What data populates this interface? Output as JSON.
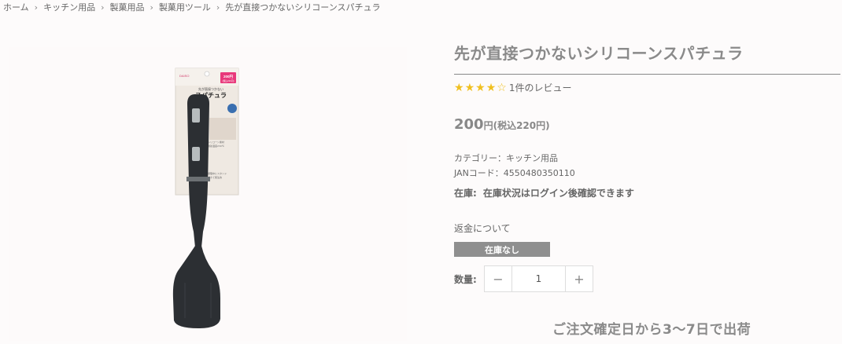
{
  "breadcrumb": [
    "ホーム",
    "キッチン用品",
    "製菓用品",
    "製菓用ツール",
    "先が直接つかないシリコーンスパチュラ"
  ],
  "product": {
    "title": "先が直接つかないシリコーンスパチュラ",
    "rating": 4,
    "rating_max": 5,
    "review_text": "1件のレビュー",
    "price": "200",
    "price_unit": "円",
    "price_tax": "(税込220円)",
    "category": "カテゴリー：キッチン用品",
    "jan": "JANコード：4550480350110",
    "stock_label": "在庫:",
    "stock_value": "在庫状況はログイン後確認できます",
    "refund_link": "返金について",
    "soldout_badge": "在庫なし",
    "quantity_label": "数量:",
    "quantity_value": "1",
    "shipping_note": "ご注文確定日から3〜7日で出荷"
  },
  "package": {
    "brand_tag": "DAISO",
    "price_tag": "200円",
    "price_tag_sub": "(税込220円)",
    "subtitle": "先が直接つかない",
    "name": "スパチュラ",
    "note_1": "シリコーン素材",
    "note_2": "耐熱温度230℃",
    "note_3": "調理中にスタンド",
    "note_4": "できて衛生的"
  },
  "colors": {
    "accent_star": "#f0c020",
    "badge": "#8f8f8f",
    "title": "#8a8a8a"
  },
  "icons": {
    "minus": "−",
    "plus": "+",
    "chevron": "›"
  }
}
